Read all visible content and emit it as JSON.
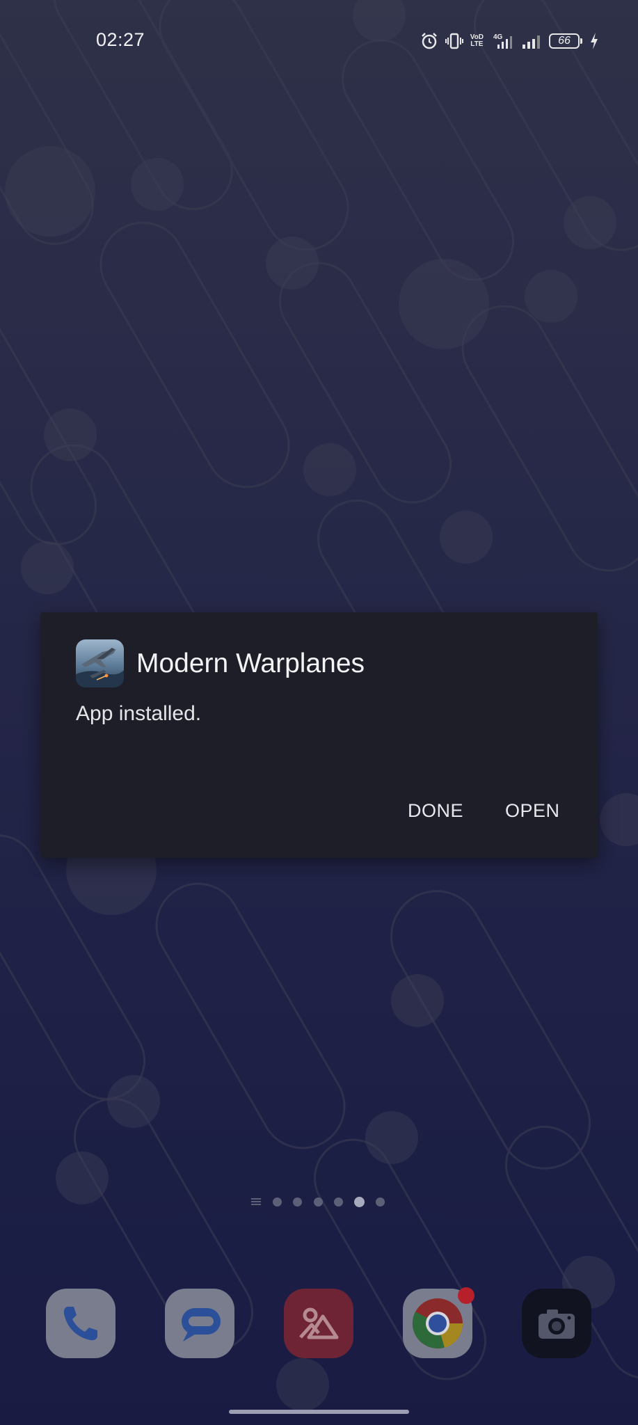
{
  "status_bar": {
    "time": "02:27",
    "icons": [
      "alarm-icon",
      "vibrate-icon",
      "volte-icon",
      "4g-signal-icon",
      "signal-icon",
      "battery-icon",
      "charging-icon"
    ],
    "volte_label_top": "VoD",
    "volte_label_bottom": "LTE",
    "network_label": "4G",
    "battery_level": "66"
  },
  "dialog": {
    "app_name": "Modern Warplanes",
    "message": "App installed.",
    "buttons": {
      "done": "DONE",
      "open": "OPEN"
    }
  },
  "home": {
    "page_count": 6,
    "active_page": 4,
    "dock": [
      {
        "name": "phone-app",
        "icon": "phone-icon"
      },
      {
        "name": "messages-app",
        "icon": "chat-icon"
      },
      {
        "name": "gallery-app",
        "icon": "gallery-icon"
      },
      {
        "name": "chrome-app",
        "icon": "chrome-icon",
        "badge": true
      },
      {
        "name": "camera-app",
        "icon": "camera-icon"
      }
    ]
  },
  "colors": {
    "dialog_bg": "#1e1e28",
    "wallpaper_top": "#3a3c58",
    "wallpaper_bottom": "#1f2252",
    "badge": "#b5202b"
  }
}
